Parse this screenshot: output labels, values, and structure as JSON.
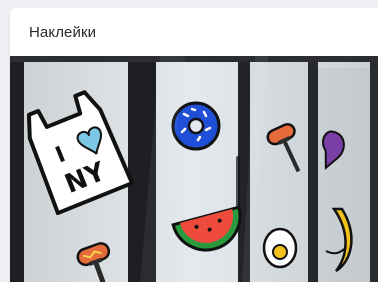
{
  "card": {
    "title": "Наклейки"
  },
  "image": {
    "sticker_text_line1": "I",
    "sticker_text_line2": "NY",
    "colors": {
      "glass": "#dfe6ea",
      "frame": "#1d1f22",
      "donut": "#1f4fd6",
      "watermelon_rind": "#2a9a3e",
      "watermelon_flesh": "#ef4b3d",
      "sausage": "#e66b3a",
      "fork": "#2a2a2a",
      "heart": "#7cc7e6",
      "banana": "#f2c21b",
      "ice_cream": "#7a3fa6"
    }
  }
}
